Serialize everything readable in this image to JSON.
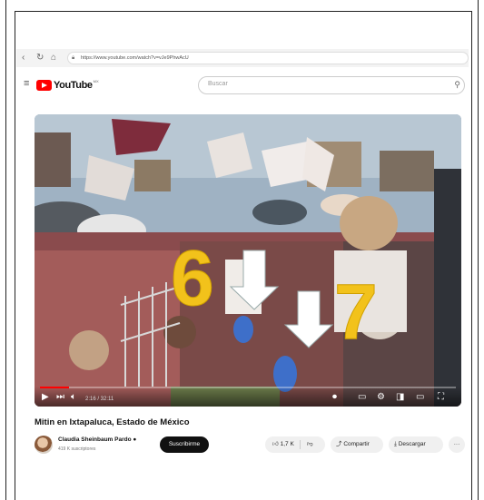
{
  "browser": {
    "url": "https://www.youtube.com/watch?v=vJe9PhwAcU",
    "icons": [
      "back-arrow",
      "refresh",
      "home",
      "lock"
    ]
  },
  "youtube": {
    "logo_text": "YouTube",
    "logo_sup": "MX",
    "search_placeholder": "Buscar"
  },
  "video": {
    "time": "2:16 / 32:11",
    "progress_fraction": 0.07,
    "overlay_numbers": [
      "6",
      "7"
    ],
    "colors": {
      "overlay_number": "#f2c21b",
      "marker_dot": "#3e6fc9",
      "arrow": "#ffffff"
    }
  },
  "meta": {
    "title": "Mitin en Ixtapaluca, Estado de México",
    "channel_name": "Claudia Sheinbaum Pardo",
    "channel_subs": "419 K suscriptores",
    "subscribe_label": "Suscribirme",
    "likes": "1,7 K",
    "share_label": "Compartir",
    "download_label": "Descargar",
    "more_label": "···"
  }
}
